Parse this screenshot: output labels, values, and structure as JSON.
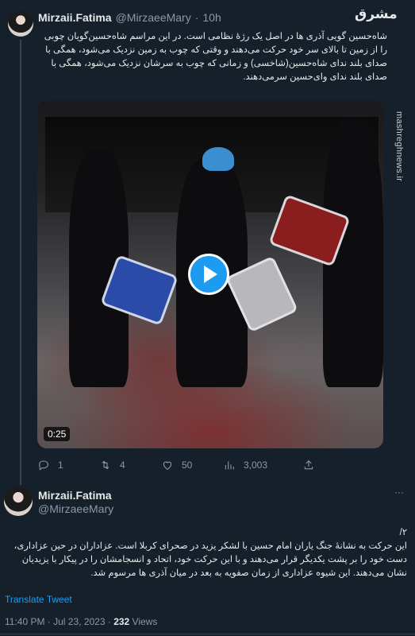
{
  "tweet1": {
    "name": "Mirzaii.Fatima",
    "handle": "@MirzaeeMary",
    "separator": "·",
    "time": "10h",
    "text": "شاه‌حسین گویی آذری ها در اصل یک رژهٔ نظامی است. در این مراسم شاه‌حسین‌گویان چوبی را از زمین تا بالای سر خود حرکت می‌دهند و وقتی که چوب به زمین نزدیک می‌شود، همگی با صدای بلند ندای شاه‌حسین(شاخسی) و زمانی که چوب به سرشان نزدیک می‌شود، همگی با صدای بلند ندای وای‌حسین سرمی‌دهند.",
    "video_duration": "0:25",
    "stats": {
      "replies": "1",
      "retweets": "4",
      "likes": "50",
      "views": "3,003"
    }
  },
  "tweet2": {
    "name": "Mirzaii.Fatima",
    "handle": "@MirzaeeMary",
    "more": "···",
    "text_line1": "۲/",
    "text": "این حرکت به نشانهٔ جنگ یاران امام حسین با لشکر یزید در صحرای کربلا است. عزاداران در حین عزاداری، دست خود را بر پشت یکدیگر قرار می‌دهند و با این حرکت خود، اتحاد و انسجامشان را در پیکار با یزیدیان نشان می‌دهند. این شیوه عزاداری از زمان صفویه به بعد در میان آذری ها مرسوم شد.",
    "translate": "Translate Tweet",
    "timestamp": "11:40 PM · Jul 23, 2023 · ",
    "views_count": "232",
    "views_label": " Views"
  },
  "watermark": {
    "logo": "مشرق",
    "url": "mashreghnews.ir"
  }
}
